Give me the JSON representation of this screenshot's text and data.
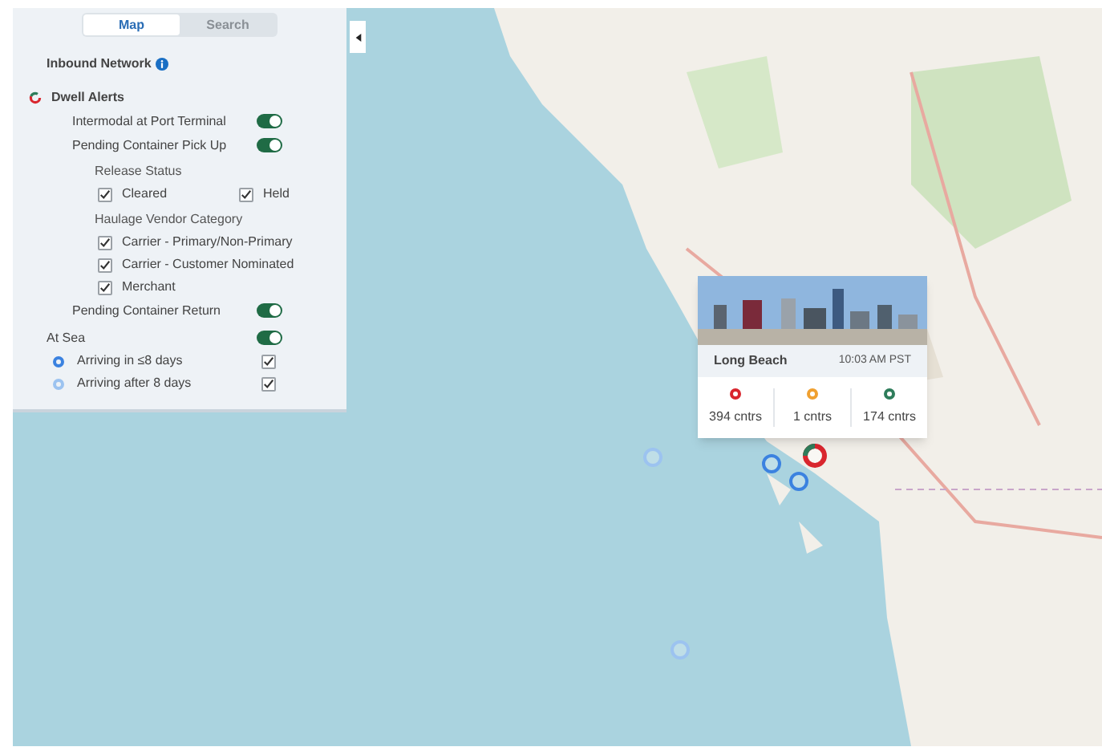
{
  "panel": {
    "tabs": [
      {
        "label": "Map",
        "selected": true
      },
      {
        "label": "Search",
        "selected": false
      }
    ],
    "title": "Inbound Network",
    "items": [
      {
        "kind": "group",
        "label": "Dwell Alerts"
      },
      {
        "kind": "toggle",
        "label": "Intermodal at Port Terminal",
        "on": true
      },
      {
        "kind": "toggle",
        "label": "Pending Container Pick Up",
        "on": true
      },
      {
        "kind": "subheading",
        "label": "Release Status"
      },
      {
        "kind": "checkbox-pair",
        "options": [
          {
            "label": "Cleared",
            "checked": true
          },
          {
            "label": "Held",
            "checked": true
          }
        ]
      },
      {
        "kind": "subheading",
        "label": "Haulage Vendor Category"
      },
      {
        "kind": "checkbox",
        "label": "Carrier - Primary/Non-Primary",
        "checked": true
      },
      {
        "kind": "checkbox",
        "label": "Carrier - Customer Nominated",
        "checked": true
      },
      {
        "kind": "checkbox",
        "label": "Merchant",
        "checked": true
      },
      {
        "kind": "toggle",
        "label": "Pending Container Return",
        "on": true
      },
      {
        "kind": "section-toggle",
        "label": "At Sea",
        "on": true
      },
      {
        "kind": "legend-check",
        "label": "Arriving in ≤8 days",
        "checked": true,
        "color": "#3b82e0"
      },
      {
        "kind": "legend-check",
        "label": "Arriving after 8 days",
        "checked": true,
        "color": "#9cc3f0"
      }
    ]
  },
  "popup": {
    "title": "Long Beach",
    "time": "10:03 AM PST",
    "stats": [
      {
        "value": "394 cntrs",
        "color": "#d9262e"
      },
      {
        "value": "1 cntrs",
        "color": "#f0a030"
      },
      {
        "value": "174 cntrs",
        "color": "#2e7d5b"
      }
    ]
  },
  "markers": [
    {
      "kind": "ring",
      "color": "#9cc3f0"
    },
    {
      "kind": "ring",
      "color": "#3b82e0"
    },
    {
      "kind": "ring",
      "color": "#3b82e0"
    },
    {
      "kind": "port",
      "color": "#d9262e"
    },
    {
      "kind": "ring",
      "color": "#9cc3f0"
    }
  ]
}
